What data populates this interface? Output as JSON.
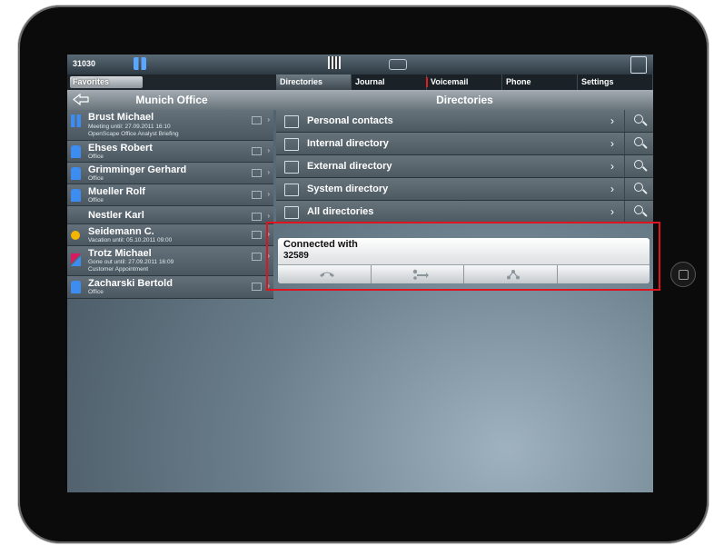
{
  "status_bar": {
    "extension": "31030",
    "icons": [
      "presence-icon",
      "dialpad-icon",
      "handset-icon",
      "exit-icon"
    ]
  },
  "favorites_button": "Favorites",
  "tabs": [
    {
      "label": "Directories",
      "active": true
    },
    {
      "label": "Journal",
      "active": false
    },
    {
      "label": "Voicemail",
      "active": false,
      "marker_color": "#e02020"
    },
    {
      "label": "Phone",
      "active": false
    },
    {
      "label": "Settings",
      "active": false
    }
  ],
  "left_panel": {
    "title": "Munich Office",
    "contacts": [
      {
        "name": "Brust Michael",
        "lines": [
          "Meeting until: 27.09.2011 16:10",
          "OpenScape Office Analyst Briefing"
        ],
        "status_color": "#3d8df0",
        "phone_glyph": "›"
      },
      {
        "name": "Ehses Robert",
        "lines": [
          "Office"
        ],
        "status_color": "#3d8df0",
        "phone_glyph": "›"
      },
      {
        "name": "Grimminger Gerhard",
        "lines": [
          "Office"
        ],
        "status_color": "#3d8df0",
        "phone_glyph": "›"
      },
      {
        "name": "Mueller Rolf",
        "lines": [
          "Office"
        ],
        "status_color": "#3d8df0",
        "phone_glyph": "›"
      },
      {
        "name": "Nestler Karl",
        "lines": [],
        "status_color": "",
        "phone_glyph": "›"
      },
      {
        "name": "Seidemann C.",
        "lines": [
          "Vacation until: 05.10.2011 09:00"
        ],
        "status_color": "#f4b400",
        "phone_glyph": "›"
      },
      {
        "name": "Trotz Michael",
        "lines": [
          "Gone out until: 27.09.2011 16:09",
          "Customer Appointment"
        ],
        "status_color": "#d81b60",
        "phone_glyph": "›"
      },
      {
        "name": "Zacharski Bertold",
        "lines": [
          "Office"
        ],
        "status_color": "#3d8df0",
        "phone_glyph": "›"
      }
    ]
  },
  "right_panel": {
    "title": "Directories",
    "items": [
      {
        "label": "Personal contacts"
      },
      {
        "label": "Internal directory"
      },
      {
        "label": "External directory"
      },
      {
        "label": "System directory"
      },
      {
        "label": "All directories"
      }
    ],
    "chevron": "›"
  },
  "call_panel": {
    "label": "Connected with",
    "number": "32589",
    "actions": [
      "hangup-icon",
      "transfer-icon",
      "conference-icon",
      ""
    ]
  },
  "colors": {
    "highlight_border": "#e0141e",
    "available": "#3d8df0",
    "away": "#f4b400",
    "busy": "#d81b60"
  }
}
